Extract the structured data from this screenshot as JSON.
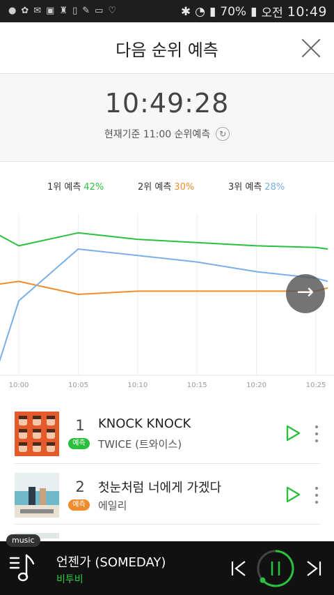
{
  "status_bar": {
    "battery": "70%",
    "ampm": "오전",
    "time": "10:49"
  },
  "header": {
    "title": "다음 순위 예측"
  },
  "clock_panel": {
    "time": "10:49:28",
    "subtitle": "현재기준 11:00 순위예측"
  },
  "legend": [
    {
      "label": "1위 예측",
      "pct": "42%",
      "color": "#2bbf3e"
    },
    {
      "label": "2위 예측",
      "pct": "30%",
      "color": "#f08c2c"
    },
    {
      "label": "3위 예측",
      "pct": "28%",
      "color": "#7aaee8"
    }
  ],
  "chart_data": {
    "type": "line",
    "x": [
      "09:58",
      "10:00",
      "10:05",
      "10:10",
      "10:15",
      "10:20",
      "10:25",
      "10:26"
    ],
    "tick_labels": [
      "10:00",
      "10:05",
      "10:10",
      "10:15",
      "10:20",
      "10:25"
    ],
    "series": [
      {
        "name": "1위 예측",
        "color": "#2bbf3e",
        "values": [
          44,
          40,
          44,
          42,
          41,
          40,
          39.5,
          39
        ]
      },
      {
        "name": "2위 예측",
        "color": "#f08c2c",
        "values": [
          28,
          29,
          25,
          26,
          26,
          26,
          26,
          27
        ]
      },
      {
        "name": "3위 예측",
        "color": "#7aaee8",
        "values": [
          0,
          23,
          39,
          37,
          35,
          32,
          30,
          29
        ]
      }
    ],
    "ylim": [
      0,
      50
    ],
    "grid": true
  },
  "songs": [
    {
      "rank": "1",
      "badge": "예측",
      "badge_color": "#2bbf3e",
      "title": "KNOCK KNOCK",
      "artist": "TWICE (트와이스)"
    },
    {
      "rank": "2",
      "badge": "예측",
      "badge_color": "#f08c2c",
      "title": "첫눈처럼 너에게 가겠다",
      "artist": "에일리"
    }
  ],
  "player": {
    "tag": "music",
    "title": "언젠가 (SOMEDAY)",
    "artist": "비투비"
  }
}
